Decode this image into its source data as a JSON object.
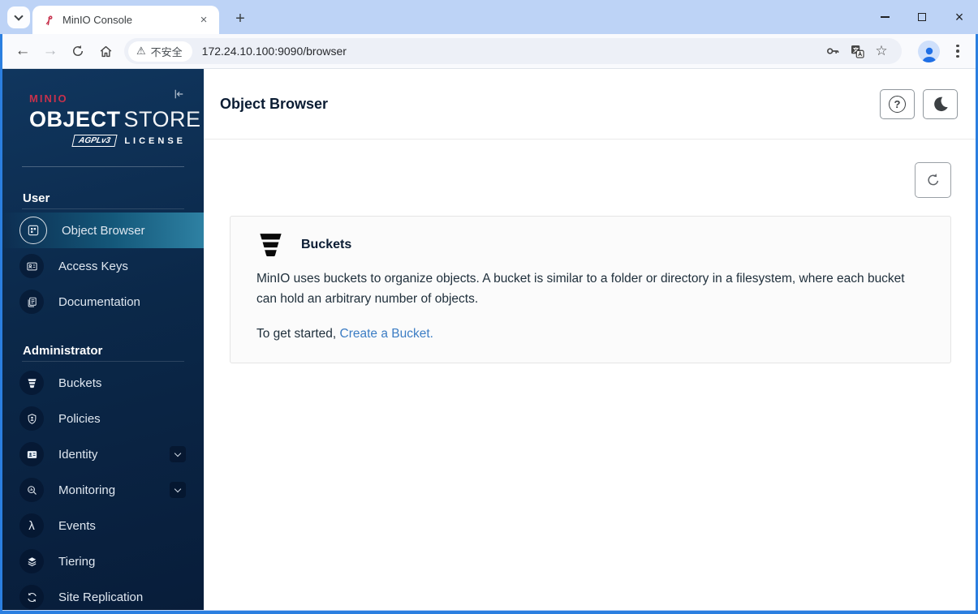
{
  "colors": {
    "brand_red": "#C7314C",
    "window_accent_border": "#2b7fe0",
    "sidebar_selected_teal": "#2e81a3",
    "link_blue": "#3c7dc4",
    "avatar_blue": "#1f6fe5"
  },
  "icons": {
    "back": "←",
    "forward": "→",
    "warning": "⚠",
    "star": "☆",
    "close_tab": "×",
    "new_tab": "+",
    "close_window": "×",
    "help": "?",
    "lambda": "λ"
  },
  "browser": {
    "tab_title": "MinIO Console",
    "security_label": "不安全",
    "url": "172.24.10.100:9090/browser"
  },
  "sidebar": {
    "logo": {
      "brand": "MINIO",
      "word_bold": "OBJECT",
      "word_light": "STORE",
      "license_badge": "AGPLv3",
      "license_label": "LICENSE"
    },
    "sections": [
      {
        "label": "User",
        "items": [
          {
            "label": "Object Browser",
            "selected": true
          },
          {
            "label": "Access Keys"
          },
          {
            "label": "Documentation"
          }
        ]
      },
      {
        "label": "Administrator",
        "items": [
          {
            "label": "Buckets"
          },
          {
            "label": "Policies"
          },
          {
            "label": "Identity",
            "expandable": true
          },
          {
            "label": "Monitoring",
            "expandable": true
          },
          {
            "label": "Events"
          },
          {
            "label": "Tiering"
          },
          {
            "label": "Site Replication"
          }
        ]
      }
    ]
  },
  "main": {
    "page_title": "Object Browser",
    "card": {
      "title": "Buckets",
      "description": "MinIO uses buckets to organize objects. A bucket is similar to a folder or directory in a filesystem, where each bucket can hold an arbitrary number of objects.",
      "cta_prefix": "To get started, ",
      "cta_link": "Create a Bucket."
    }
  }
}
